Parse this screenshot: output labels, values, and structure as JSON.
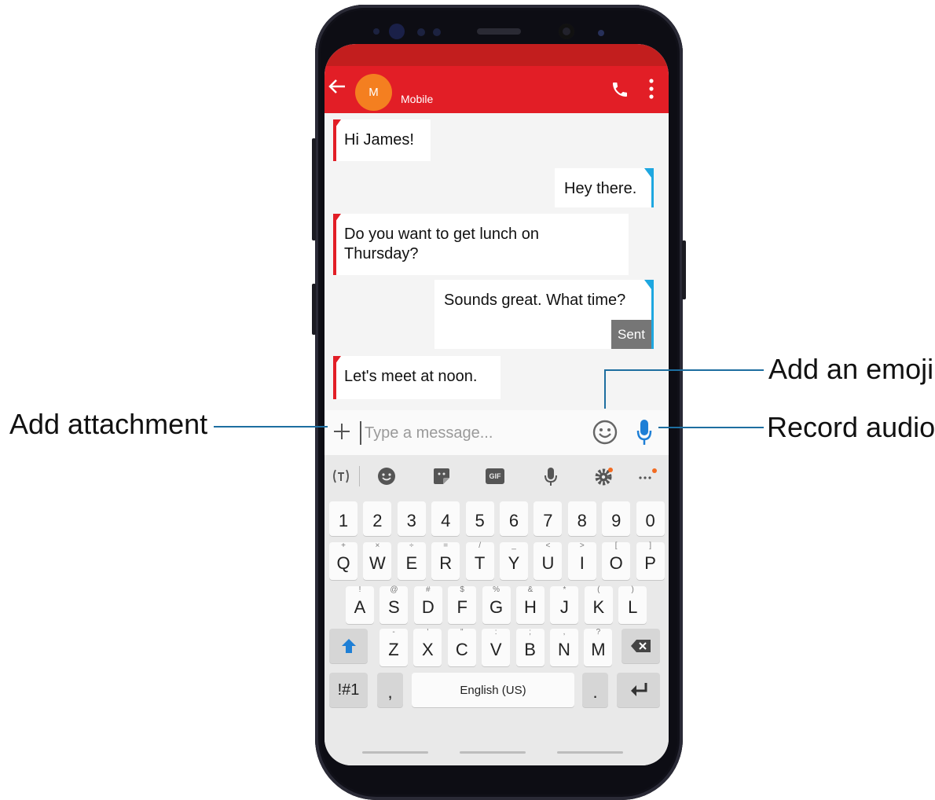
{
  "header": {
    "avatar_initial": "M",
    "contact_label": "Mobile"
  },
  "messages": [
    {
      "direction": "received",
      "text": "Hi James!"
    },
    {
      "direction": "sent",
      "text": "Hey there."
    },
    {
      "direction": "received",
      "text": "Do you want to get lunch on Thursday?"
    },
    {
      "direction": "sent",
      "text": "Sounds great. What time?",
      "status": "Sent"
    },
    {
      "direction": "received",
      "text": "Let's meet at noon."
    }
  ],
  "composer": {
    "placeholder": "Type a message..."
  },
  "keyboard": {
    "toolbar_icons": [
      "translate-icon",
      "emoji-icon",
      "sticker-icon",
      "gif-icon",
      "voice-input-icon",
      "settings-icon",
      "more-icon"
    ],
    "gif_label": "GIF",
    "number_row": [
      "1",
      "2",
      "3",
      "4",
      "5",
      "6",
      "7",
      "8",
      "9",
      "0"
    ],
    "row1": [
      {
        "key": "Q",
        "hint": "+"
      },
      {
        "key": "W",
        "hint": "×"
      },
      {
        "key": "E",
        "hint": "÷"
      },
      {
        "key": "R",
        "hint": "="
      },
      {
        "key": "T",
        "hint": "/"
      },
      {
        "key": "Y",
        "hint": "_"
      },
      {
        "key": "U",
        "hint": "<"
      },
      {
        "key": "I",
        "hint": ">"
      },
      {
        "key": "O",
        "hint": "["
      },
      {
        "key": "P",
        "hint": "]"
      }
    ],
    "row2": [
      {
        "key": "A",
        "hint": "!"
      },
      {
        "key": "S",
        "hint": "@"
      },
      {
        "key": "D",
        "hint": "#"
      },
      {
        "key": "F",
        "hint": "$"
      },
      {
        "key": "G",
        "hint": "%"
      },
      {
        "key": "H",
        "hint": "&"
      },
      {
        "key": "J",
        "hint": "*"
      },
      {
        "key": "K",
        "hint": "("
      },
      {
        "key": "L",
        "hint": ")"
      }
    ],
    "row3": [
      {
        "key": "Z",
        "hint": "-"
      },
      {
        "key": "X",
        "hint": "'"
      },
      {
        "key": "C",
        "hint": "\""
      },
      {
        "key": "V",
        "hint": ":"
      },
      {
        "key": "B",
        "hint": ";"
      },
      {
        "key": "N",
        "hint": ","
      },
      {
        "key": "M",
        "hint": "?"
      }
    ],
    "symbols_key": "!#1",
    "comma_key": ",",
    "space_label": "English (US)",
    "period_key": "."
  },
  "callouts": {
    "add_emoji": "Add an emoji",
    "add_attachment": "Add attachment",
    "record_audio": "Record audio"
  },
  "colors": {
    "appbar": "#e21e26",
    "statusbar": "#c21e1e",
    "avatar": "#f47f20",
    "sent_indicator": "#1ea7e0",
    "accent_blue": "#1e7fd6",
    "callout_line": "#1d6ea0"
  }
}
